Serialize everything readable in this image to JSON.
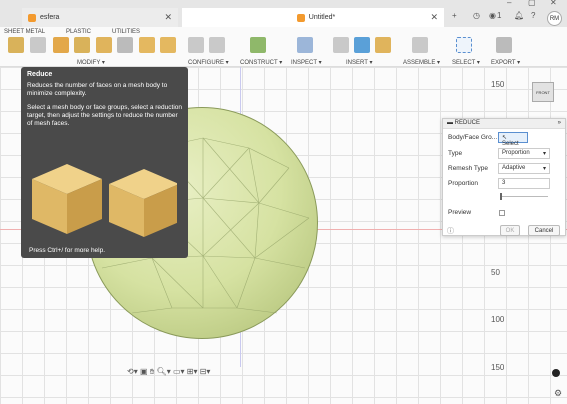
{
  "tabs": [
    {
      "label": "esfera",
      "close": "✕"
    },
    {
      "label": "Untitled*",
      "close": "✕"
    }
  ],
  "top_right": {
    "add": "+",
    "jobs": "1",
    "avatar_initials": "RM"
  },
  "ribbon": {
    "tabs": [
      "SHEET METAL",
      "PLASTIC",
      "UTILITIES"
    ],
    "groups": [
      "MODIFY ▾",
      "CONFIGURE ▾",
      "CONSTRUCT ▾",
      "INSPECT ▾",
      "INSERT ▾",
      "ASSEMBLE ▾",
      "SELECT ▾",
      "EXPORT ▾"
    ]
  },
  "tooltip": {
    "title": "Reduce",
    "p1": "Reduces the number of faces on a mesh body to minimize complexity.",
    "p2": "Select a mesh body or face groups, select a reduction target, then adjust the settings to reduce the number of mesh faces.",
    "help": "Press Ctrl+/ for more help."
  },
  "panel": {
    "title": "REDUCE",
    "rows": [
      {
        "label": "Body/Face Gro...",
        "value": "Select"
      },
      {
        "label": "Type",
        "value": "Proportion"
      },
      {
        "label": "Remesh Type",
        "value": "Adaptive"
      },
      {
        "label": "Proportion",
        "value": "3"
      },
      {
        "label": "Preview",
        "value": ""
      }
    ],
    "ok": "OK",
    "cancel": "Cancel"
  },
  "ruler": [
    "150",
    "50",
    "100",
    "150"
  ],
  "viewcube": {
    "face": "FRONT"
  }
}
